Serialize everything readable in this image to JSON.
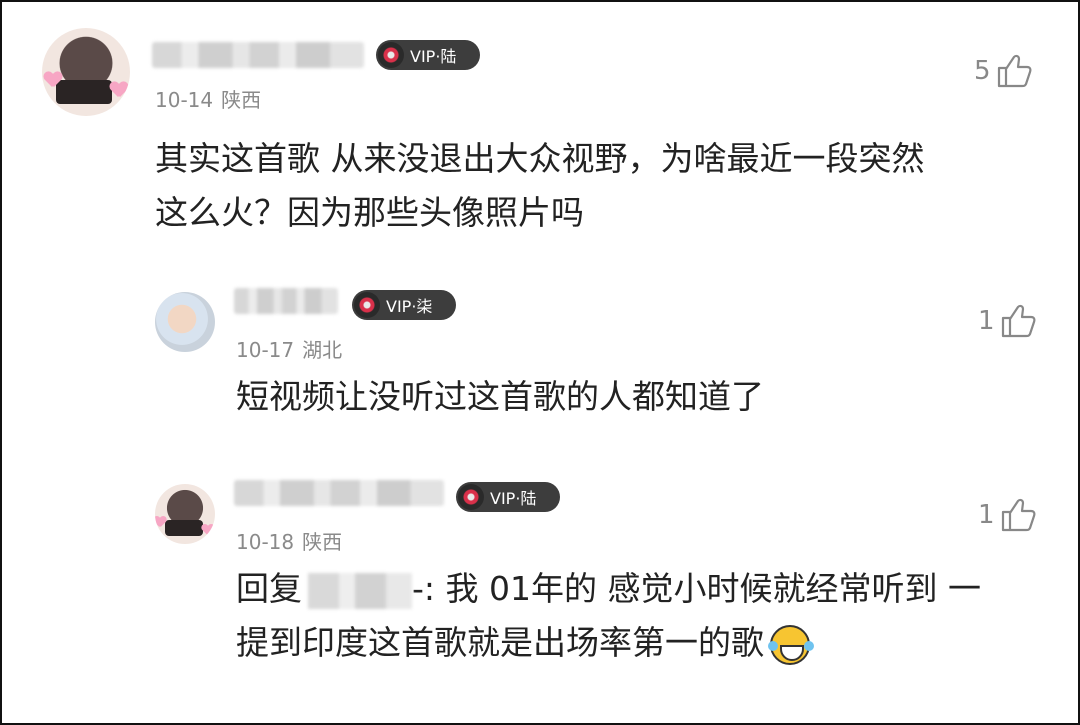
{
  "comments": [
    {
      "vip_label": "VIP·陆",
      "date": "10-14",
      "location": "陕西",
      "likes": "5",
      "text_line1": "其实这首歌 从来没退出大众视野，为啥最近一段突然",
      "text_line2": "这么火？因为那些头像照片吗"
    },
    {
      "vip_label": "VIP·柒",
      "date": "10-17",
      "location": "湖北",
      "likes": "1",
      "text_line1": "短视频让没听过这首歌的人都知道了"
    },
    {
      "vip_label": "VIP·陆",
      "date": "10-18",
      "location": "陕西",
      "likes": "1",
      "reply_prefix": "回复",
      "reply_suffix": "-: 我 01年的 感觉小时候就经常听到 一",
      "text_line2": "提到印度这首歌就是出场率第一的歌"
    }
  ],
  "icons": {
    "like": "thumbs-up-icon",
    "vip_disc": "vinyl-record-icon",
    "emoji": "laughing-tears-emoji"
  },
  "colors": {
    "text": "#222222",
    "meta": "#8a8a8a",
    "vip_badge": "#3d3d3d",
    "disc_red": "#d9304a"
  }
}
